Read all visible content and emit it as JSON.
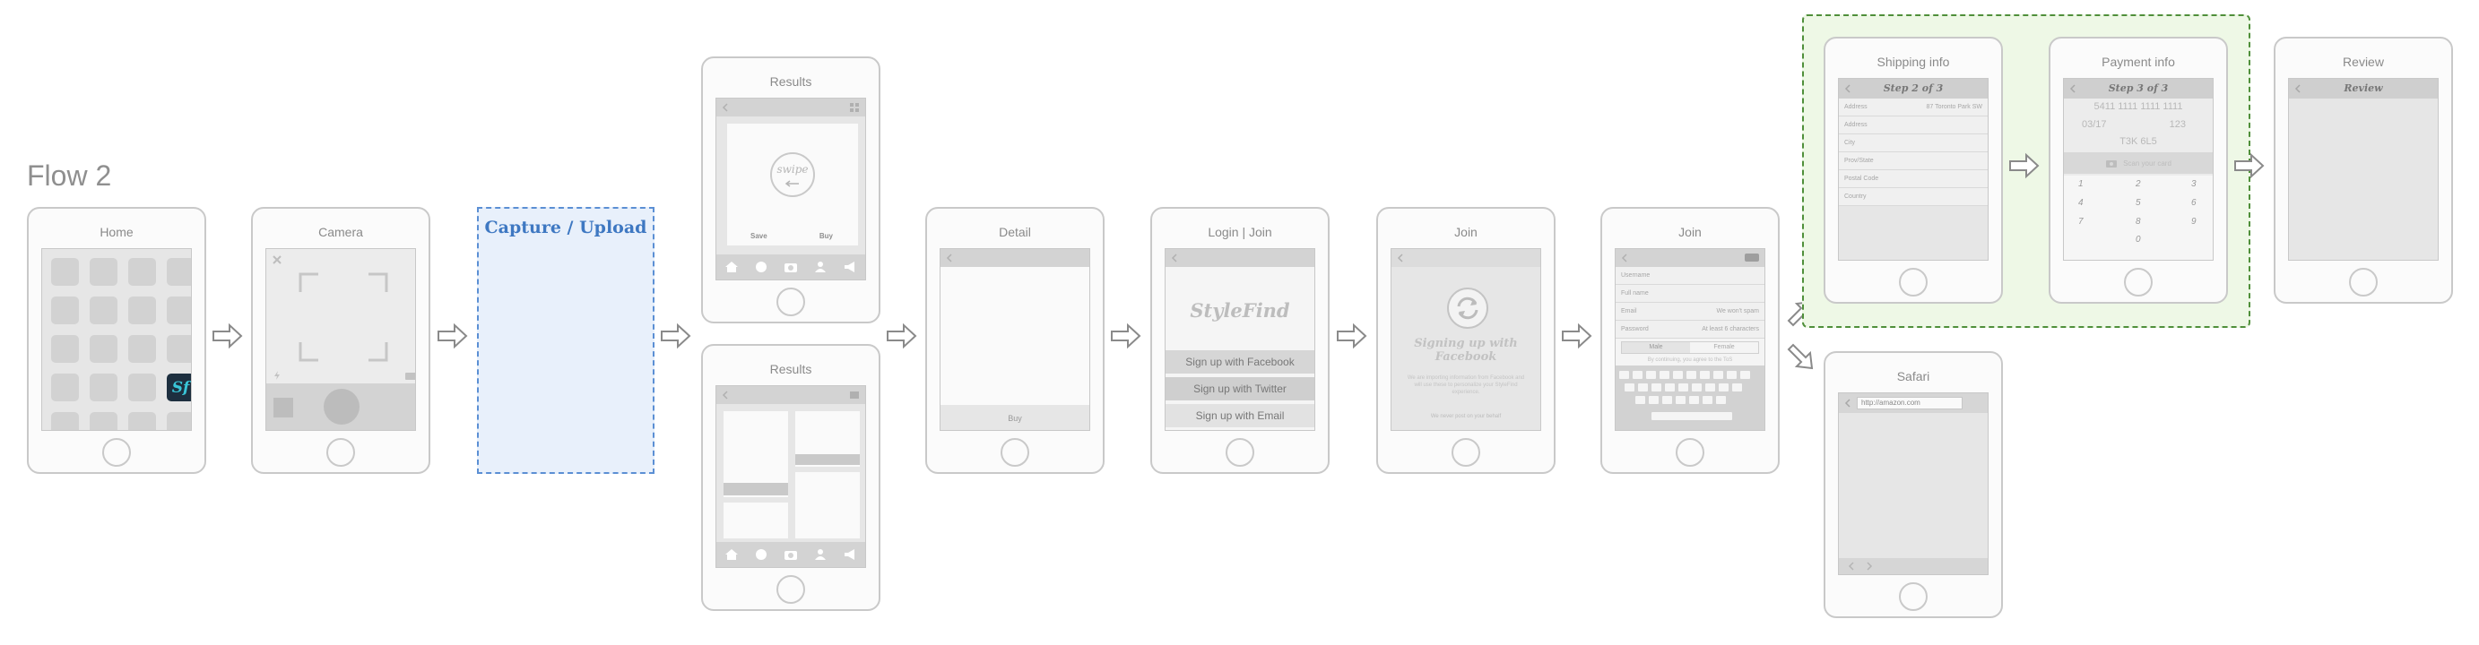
{
  "flow": {
    "title": "Flow 2"
  },
  "home": {
    "title": "Home",
    "brand_letter": "Sf"
  },
  "camera": {
    "title": "Camera"
  },
  "capture": {
    "label": "Capture / Upload"
  },
  "results_top": {
    "title": "Results",
    "swipe": "swipe",
    "save": "Save",
    "buy": "Buy"
  },
  "results_bottom": {
    "title": "Results"
  },
  "detail": {
    "title": "Detail",
    "buy": "Buy"
  },
  "login": {
    "title": "Login | Join",
    "logo": "StyleFind",
    "buttons": [
      "Sign up with Facebook",
      "Sign up with Twitter",
      "Sign up with Email"
    ]
  },
  "join_fb": {
    "title": "Join",
    "status": "Signing up with Facebook",
    "note": "We are importing information from Facebook and will use these to personalize your StyleFind experience.",
    "footer": "We never post on your behalf"
  },
  "join_form": {
    "title": "Join",
    "fields": [
      {
        "label": "Username",
        "hint": ""
      },
      {
        "label": "Full name",
        "hint": ""
      },
      {
        "label": "Email",
        "hint": "We won't spam"
      },
      {
        "label": "Password",
        "hint": "At least 6 characters"
      }
    ],
    "gender": [
      "Male",
      "Female"
    ],
    "terms": "By continuing, you agree to the ToS"
  },
  "shipping": {
    "title": "Shipping info",
    "step": "Step 2 of 3",
    "fields": [
      {
        "label": "Address",
        "value": "87 Toronto Park SW"
      },
      {
        "label": "Address",
        "value": ""
      },
      {
        "label": "City",
        "value": ""
      },
      {
        "label": "Prov/State",
        "value": ""
      },
      {
        "label": "Postal Code",
        "value": ""
      },
      {
        "label": "Country",
        "value": ""
      }
    ]
  },
  "payment": {
    "title": "Payment info",
    "step": "Step 3 of 3",
    "card": "5411 1111 1111 1111",
    "expiry": "03/17",
    "cvv": "123",
    "postal": "T3K 6L5",
    "scan": "Scan your card",
    "keypad": [
      "1",
      "2",
      "3",
      "4",
      "5",
      "6",
      "7",
      "8",
      "9",
      "0"
    ]
  },
  "review": {
    "title": "Review",
    "header": "Review"
  },
  "safari": {
    "title": "Safari",
    "url": "http://amazon.com"
  }
}
